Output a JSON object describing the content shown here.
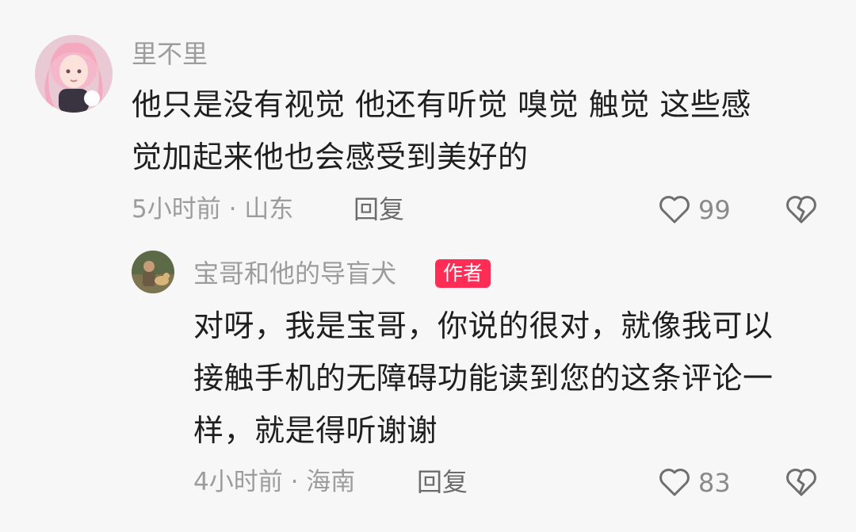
{
  "comment": {
    "avatar": "girl-avatar",
    "username": "里不里",
    "text_lines": [
      "他只是没有视觉 他还有听觉 嗅觉 触觉 这些感",
      "觉加起来他也会感受到美好的"
    ],
    "meta": "5小时前 · 山东",
    "reply_label": "回复",
    "like_count": "99",
    "like_icon": "heart-icon",
    "dislike_icon": "broken-heart-icon"
  },
  "reply_comment": {
    "avatar": "man-with-dog-avatar",
    "username": "宝哥和他的导盲犬",
    "badge": "作者",
    "text_lines": [
      "对呀，我是宝哥，你说的很对，就像我可以",
      "接触手机的无障碍功能读到您的这条评论一",
      "样，就是得听谢谢"
    ],
    "meta": "4小时前 · 海南",
    "reply_label": "回复",
    "like_count": "83",
    "like_icon": "heart-icon",
    "dislike_icon": "broken-heart-icon"
  },
  "colors": {
    "background": "#f7f7f7",
    "badge": "#ff2c55",
    "text": "#1f1f1f",
    "muted": "#9c9c9c"
  }
}
